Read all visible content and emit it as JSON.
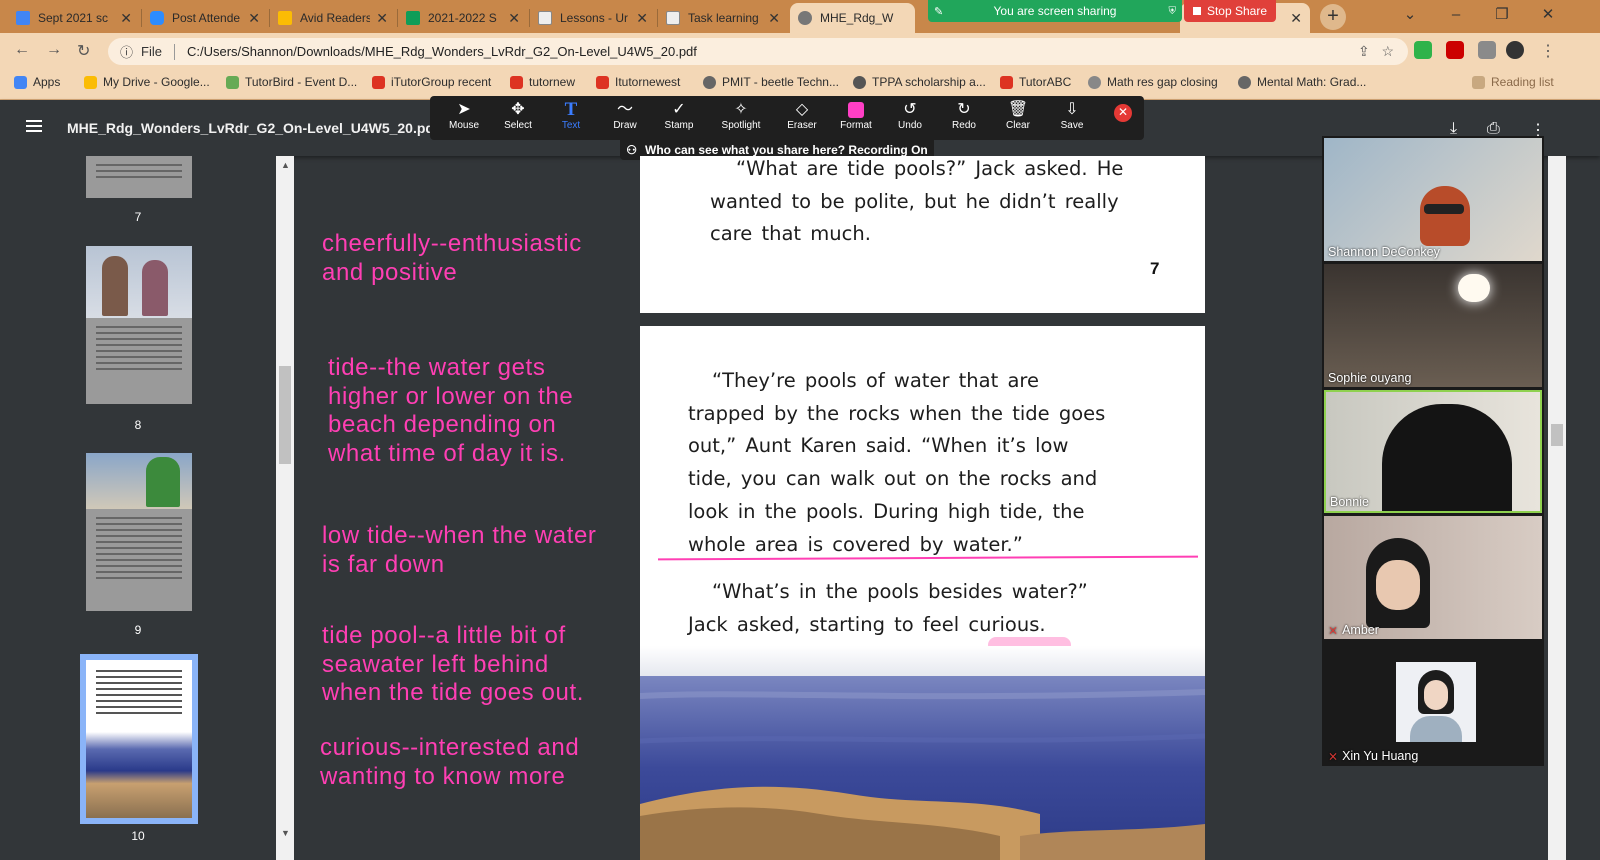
{
  "browser": {
    "tabs": [
      {
        "title": "Sept 2021 sc",
        "color": "#4285f4"
      },
      {
        "title": "Post Attende",
        "color": "#2d8cff"
      },
      {
        "title": "Avid Readers",
        "color": "#fbbc04"
      },
      {
        "title": "2021-2022 S",
        "color": "#0f9d58"
      },
      {
        "title": "Lessons - Ur",
        "color": "#9aa0a6"
      },
      {
        "title": "Task learning",
        "color": "#9aa0a6"
      },
      {
        "title": "MHE_Rdg_W",
        "color": "#777777"
      }
    ],
    "share_banner": "You are screen sharing",
    "stop_share": "Stop Share",
    "file_label": "File",
    "url": "C:/Users/Shannon/Downloads/MHE_Rdg_Wonders_LvRdr_G2_On-Level_U4W5_20.pdf",
    "bookmarks": [
      "Apps",
      "My Drive - Google...",
      "TutorBird - Event D...",
      "iTutorGroup recent",
      "tutornew",
      "Itutornewest",
      "PMIT - beetle Techn...",
      "TPPA scholarship a...",
      "TutorABC",
      "Math res gap closing",
      "Mental Math: Grad...",
      "Reading list"
    ]
  },
  "pdf": {
    "title": "MHE_Rdg_Wonders_LvRdr_G2_On-Level_U4W5_20.pdf",
    "thumbnail_pages": [
      "7",
      "8",
      "9",
      "10"
    ],
    "page7": {
      "lines": [
        "“What are tide pools?” Jack asked. He",
        "wanted to be polite, but he didn’t really",
        "care that much."
      ],
      "number": "7"
    },
    "page8": {
      "lines": [
        "“They’re pools of water that are",
        "trapped by the rocks when the tide goes",
        "out,” Aunt Karen said. “When it’s low",
        "tide, you can walk out on the rocks and",
        "look in the pools. During high tide, the",
        "whole area is covered by water.”",
        "“What’s in the pools besides water?”",
        "Jack asked, starting to feel curious."
      ]
    }
  },
  "annotation_toolbar": {
    "tools": [
      "Mouse",
      "Select",
      "Text",
      "Draw",
      "Stamp",
      "Spotlight",
      "Eraser",
      "Format",
      "Undo",
      "Redo",
      "Clear",
      "Save"
    ],
    "active_tool": "Text",
    "recording_notice": "Who can see what you share here? Recording On"
  },
  "notes": [
    [
      "cheerfully--enthusiastic",
      "and positive"
    ],
    [
      "tide--the water gets",
      "higher or lower on the",
      "beach depending on",
      "what time of day it is."
    ],
    [
      "low tide--when the water",
      "is far down"
    ],
    [
      "tide pool--a little bit of",
      "seawater left behind",
      "when the tide goes out."
    ],
    [
      "curious--interested and",
      "wanting to know more"
    ]
  ],
  "participants": [
    {
      "name": "Shannon DeConkey",
      "muted": false
    },
    {
      "name": "Sophie ouyang",
      "muted": false
    },
    {
      "name": "Bonnie",
      "muted": false
    },
    {
      "name": "Amber",
      "muted": true
    },
    {
      "name": "Xin Yu Huang",
      "muted": true
    }
  ],
  "colors": {
    "annotation_pink": "#ff3fb4",
    "tab_bar": "#c8874a",
    "active_tool": "#3b7dff"
  }
}
